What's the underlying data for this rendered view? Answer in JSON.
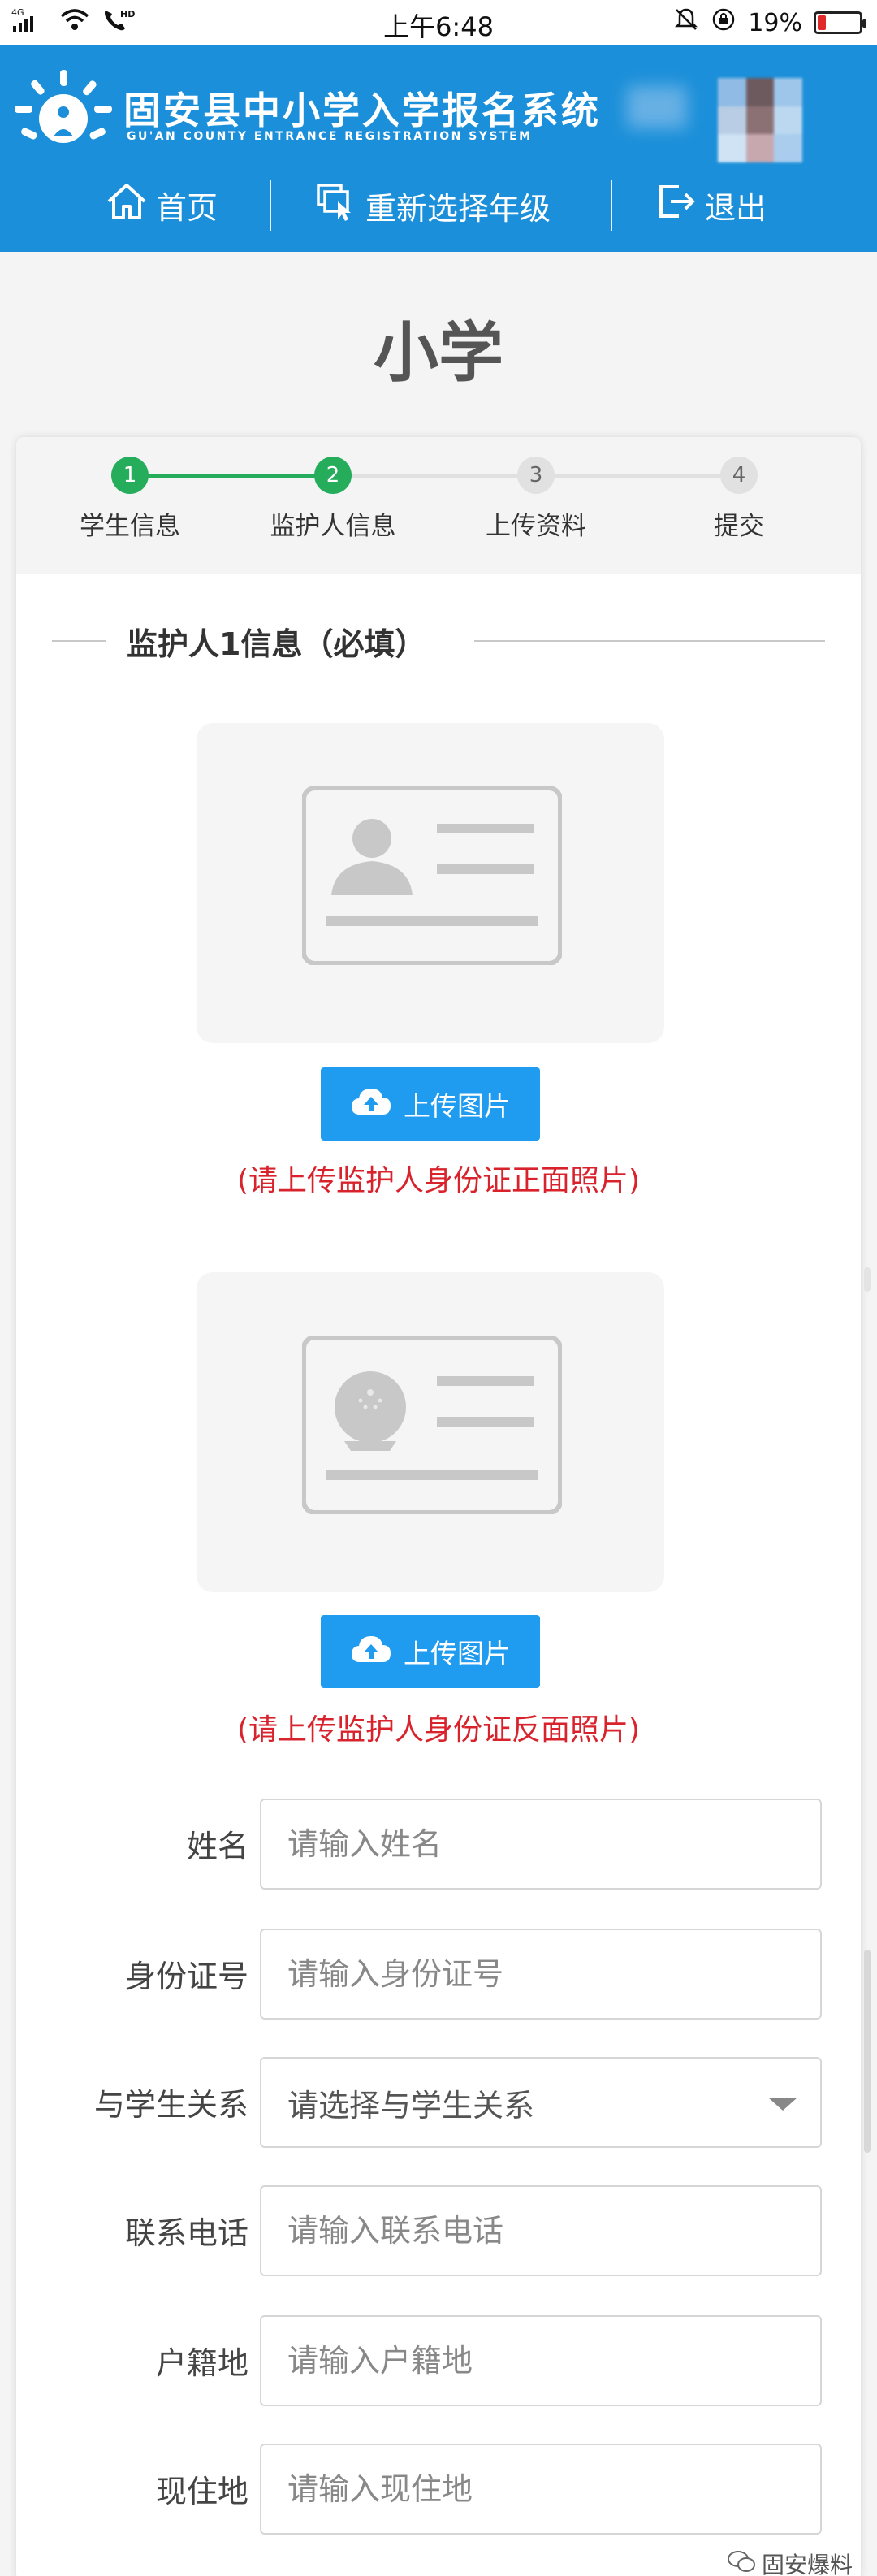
{
  "status_bar": {
    "network": "4G",
    "call_badge": "HD",
    "time": "上午6:48",
    "battery": "19%",
    "battery_level": 0.19,
    "battery_color": "#e02a2a"
  },
  "header": {
    "title": "固安县中小学入学报名系统",
    "subtitle": "GU'AN COUNTY ENTRANCE REGISTRATION SYSTEM",
    "bg_color": "#1b8fd9",
    "nav": [
      {
        "label": "首页",
        "icon": "home-icon"
      },
      {
        "label": "重新选择年级",
        "icon": "reselect-icon"
      },
      {
        "label": "退出",
        "icon": "logout-icon"
      }
    ]
  },
  "page_title": "小学",
  "steps": [
    {
      "num": "1",
      "label": "学生信息",
      "state": "done"
    },
    {
      "num": "2",
      "label": "监护人信息",
      "state": "done"
    },
    {
      "num": "3",
      "label": "上传资料",
      "state": "todo"
    },
    {
      "num": "4",
      "label": "提交",
      "state": "todo"
    }
  ],
  "section_title": "监护人1信息（必填）",
  "uploads": [
    {
      "button": "上传图片",
      "hint": "(请上传监护人身份证正面照片)",
      "icon": "id-card-front-icon"
    },
    {
      "button": "上传图片",
      "hint": "(请上传监护人身份证反面照片)",
      "icon": "id-card-back-icon"
    }
  ],
  "form": {
    "name": {
      "label": "姓名",
      "placeholder": "请输入姓名"
    },
    "id_number": {
      "label": "身份证号",
      "placeholder": "请输入身份证号"
    },
    "relation": {
      "label": "与学生关系",
      "placeholder": "请选择与学生关系"
    },
    "phone": {
      "label": "联系电话",
      "placeholder": "请输入联系电话"
    },
    "household": {
      "label": "户籍地",
      "placeholder": "请输入户籍地"
    },
    "residence": {
      "label": "现住地",
      "placeholder": "请输入现住地"
    }
  },
  "watermark": "固安爆料",
  "colors": {
    "accent": "#1f9bf0",
    "step_done": "#25ad5c",
    "hint_red": "#d9232c"
  }
}
